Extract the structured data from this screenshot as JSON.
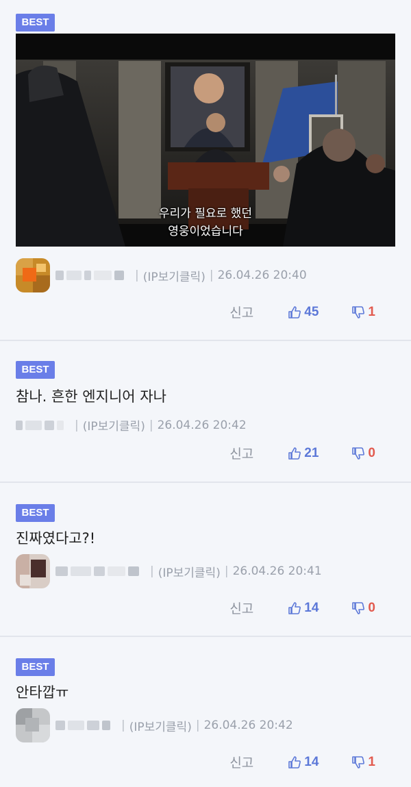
{
  "comments": [
    {
      "badge": "BEST",
      "image_subtitle_line1": "우리가 필요로 했던",
      "image_subtitle_line2": "영웅이었습니다",
      "ip_label": "(IP보기클릭)",
      "timestamp": "26.04.26 20:40",
      "report": "신고",
      "likes": "45",
      "dislikes": "1"
    },
    {
      "badge": "BEST",
      "text": "참나. 흔한 엔지니어 자나",
      "ip_label": "(IP보기클릭)",
      "timestamp": "26.04.26 20:42",
      "report": "신고",
      "likes": "21",
      "dislikes": "0"
    },
    {
      "badge": "BEST",
      "text": "진짜였다고?!",
      "ip_label": "(IP보기클릭)",
      "timestamp": "26.04.26 20:41",
      "report": "신고",
      "likes": "14",
      "dislikes": "0"
    },
    {
      "badge": "BEST",
      "text": "안타깝ㅠ",
      "ip_label": "(IP보기클릭)",
      "timestamp": "26.04.26 20:42",
      "report": "신고",
      "likes": "14",
      "dislikes": "1"
    }
  ],
  "colors": {
    "badge": "#6a7ee8",
    "like": "#5c78d8",
    "dislike": "#e25a4e",
    "background": "#f4f6fa"
  },
  "icons": {
    "like": "thumbs-up-icon",
    "dislike": "thumbs-down-icon"
  }
}
